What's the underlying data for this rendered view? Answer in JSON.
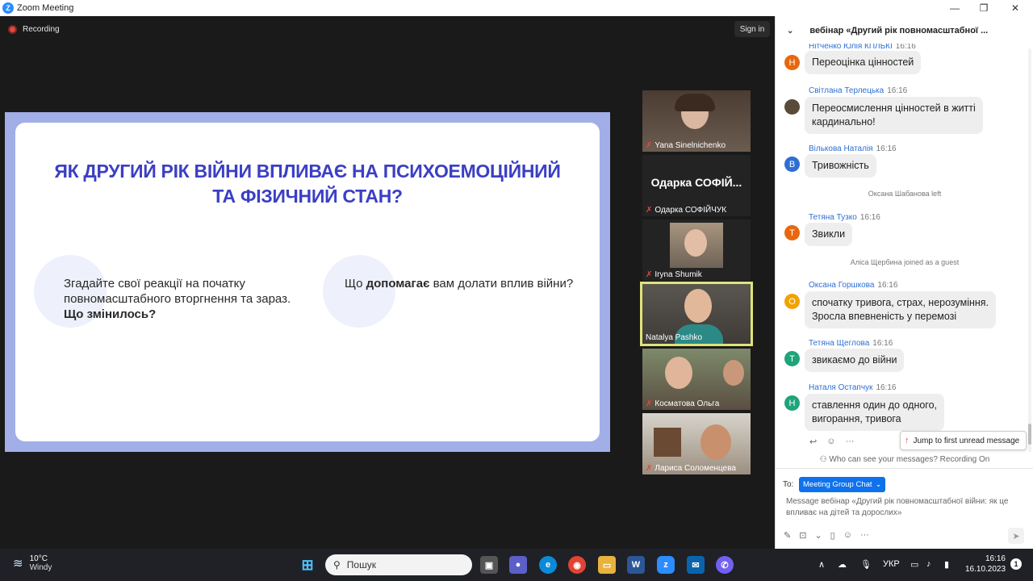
{
  "window": {
    "title": "Zoom Meeting",
    "minimize": "—",
    "maximize": "❐",
    "close": "✕"
  },
  "meeting": {
    "recording_label": "Recording",
    "signin_label": "Sign in"
  },
  "slide": {
    "title_line1": "ЯК ДРУГИЙ РІК ВІЙНИ ВПЛИВАЄ НА ПСИХОЕМОЦІЙНИЙ",
    "title_line2": "ТА ФІЗИЧНИЙ СТАН?",
    "question1_text": "Згадайте свої реакції на початку повномасштабного вторгнення та зараз.",
    "question1_bold": "Що змінилось?",
    "question2_pre": "Що ",
    "question2_bold": "допомагає",
    "question2_post": " вам долати вплив війни?"
  },
  "participants": [
    {
      "name": "Yana Sinelnichenko",
      "muted": true
    },
    {
      "name": "Одарка СОФІЙЧУК",
      "display": "Одарка СОФІЙ...",
      "muted": true
    },
    {
      "name": "Iryna Shumik",
      "muted": true
    },
    {
      "name": "Natalya Pashko",
      "muted": false,
      "active": true
    },
    {
      "name": "Косматова Ольга",
      "muted": true
    },
    {
      "name": "Лариса Соломенцева",
      "muted": true
    }
  ],
  "chat": {
    "header_title": "вебінар «Другий рік повномасштабної ...",
    "messages": [
      {
        "sender": "Нітченко Юлія КПЛЬКІ",
        "time": "16:16",
        "avatar": "Н",
        "avatar_color": "#e8670e",
        "lines": [
          "Переоцінка цінностей"
        ]
      },
      {
        "sender": "Світлана Терлецька",
        "time": "16:16",
        "avatar": "",
        "avatar_color": "#5a4a3a",
        "lines": [
          "Переосмислення цінностей в житті",
          "кардинально!"
        ]
      },
      {
        "sender": "Вількова Наталія",
        "time": "16:16",
        "avatar": "В",
        "avatar_color": "#2d6fd4",
        "lines": [
          "Тривожність"
        ]
      },
      {
        "sender": "Тетяна Тузко",
        "time": "16:16",
        "avatar": "Т",
        "avatar_color": "#e8670e",
        "lines": [
          "Звикли"
        ]
      },
      {
        "sender": "Оксана Горшкова",
        "time": "16:16",
        "avatar": "О",
        "avatar_color": "#f0a300",
        "lines": [
          "спочатку тривога, страх, нерозуміння.",
          "Зросла впевненість у перемозі"
        ]
      },
      {
        "sender": "Тетяна Щеглова",
        "time": "16:16",
        "avatar": "Т",
        "avatar_color": "#1fa37a",
        "lines": [
          "звикаємо до війни"
        ]
      },
      {
        "sender": "Наталя Остапчук",
        "time": "16:16",
        "avatar": "Н",
        "avatar_color": "#1fa37a",
        "lines": [
          "ставлення один до одного,",
          "вигорання, тривога"
        ]
      }
    ],
    "system_left": "Оксана Шабанова left",
    "system_joined": "Аліса Щербина joined as a guest",
    "jump_label": "Jump to first unread message",
    "who_can_see": "Who can see your messages? Recording On",
    "to_label": "To:",
    "to_value": "Meeting Group Chat",
    "composer_placeholder": "Message вебінар «Другий рік повномасштабної війни: як це впливає на дітей та дорослих»"
  },
  "taskbar": {
    "temperature": "10°C",
    "weather": "Windy",
    "search_placeholder": "Пошук",
    "language": "УКР",
    "time": "16:16",
    "date": "16.10.2023",
    "notification_count": "1"
  }
}
